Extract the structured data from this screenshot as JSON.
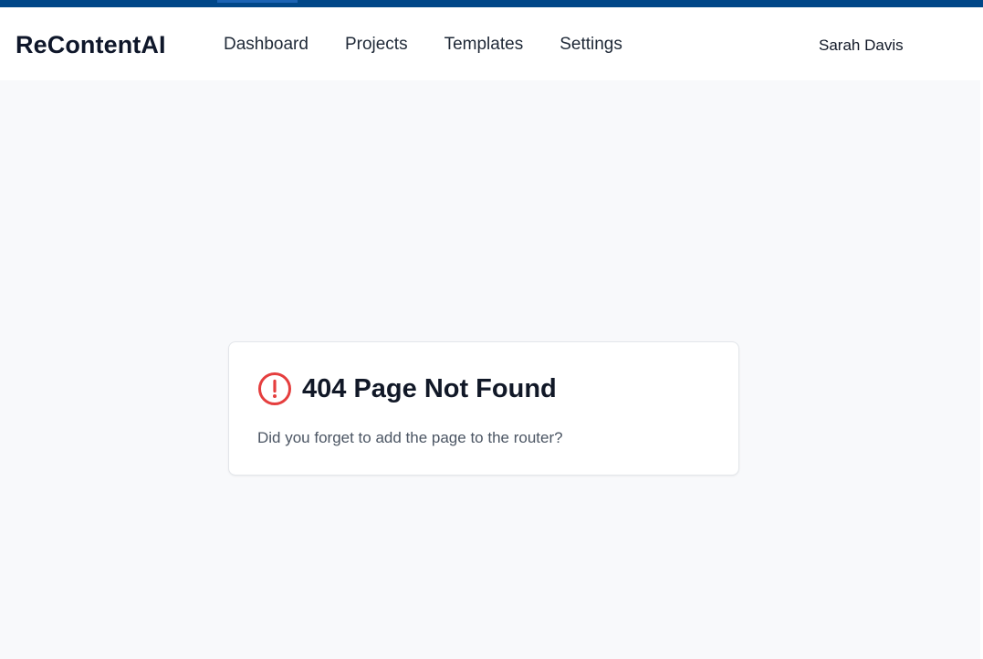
{
  "app": {
    "brand": "ReContentAI"
  },
  "nav": {
    "items": [
      {
        "label": "Dashboard"
      },
      {
        "label": "Projects"
      },
      {
        "label": "Templates"
      },
      {
        "label": "Settings"
      }
    ]
  },
  "user": {
    "name": "Sarah Davis"
  },
  "error_card": {
    "icon": "alert-circle-icon",
    "title": "404 Page Not Found",
    "message": "Did you forget to add the page to the router?"
  },
  "colors": {
    "top_strip": "#004788",
    "error_icon": "#e53e3e",
    "background": "#f8f9fb"
  }
}
